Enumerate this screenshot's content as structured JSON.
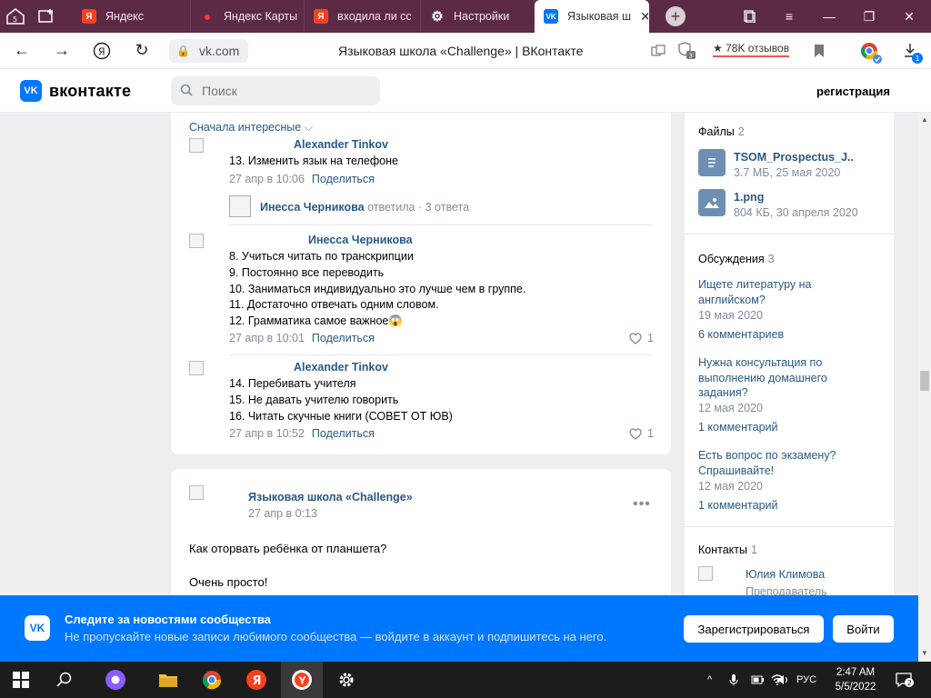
{
  "browser": {
    "tabs": [
      {
        "label": "Яндекс",
        "color": "#fc3f1d",
        "glyph": "Я"
      },
      {
        "label": "Яндекс Карты",
        "color": "#ff3333",
        "glyph": "●"
      },
      {
        "label": "входила ли сс",
        "color": "#fc3f1d",
        "glyph": "Я"
      },
      {
        "label": "Настройки",
        "color": "#5d2a45",
        "glyph": "⚙"
      },
      {
        "label": "Языковая ш",
        "color": "#0077ff",
        "glyph": "VK"
      }
    ],
    "address": "vk.com",
    "page_title": "Языковая школа «Challenge» | ВКонтакте",
    "reviews": "★ 78K отзывов",
    "badge_shield": "3",
    "badge_download": "1"
  },
  "vk_header": {
    "logo_text": "VK",
    "wordmark": "вконтакте",
    "search_placeholder": "Поиск",
    "register_link": "регистрация"
  },
  "comments": {
    "sort_label": "Сначала интересные",
    "share_label": "Поделиться",
    "c1": {
      "author": "Alexander Tinkov",
      "text": "13. Изменить язык на телефоне",
      "date": "27 апр в 10:06"
    },
    "reply_summary": {
      "author": "Инесса Черникова",
      "verb": "ответила",
      "count": "3 ответа"
    },
    "c2": {
      "author": "Инесса Черникова",
      "lines": [
        "8. Учиться читать по транскрипции",
        "9. Постоянно все переводить",
        "10. Заниматься индивидуально это лучше чем в группе.",
        "11. Достаточно отвечать одним словом.",
        "12. Грамматика самое важное😱"
      ],
      "date": "27 апр в 10:01",
      "likes": "1"
    },
    "c3": {
      "author": "Alexander Tinkov",
      "lines": [
        "14. Перебивать учителя",
        "15. Не давать учителю говорить",
        "16. Читать скучные книги (СОВЕТ ОТ ЮВ)"
      ],
      "date": "27 апр в 10:52",
      "likes": "1"
    }
  },
  "post": {
    "author": "Языковая школа «Challenge»",
    "date": "27 апр в 0:13",
    "more": "•••",
    "text1": "Как оторвать ребёнка от планшета?",
    "text2": "Очень просто!"
  },
  "right": {
    "files": {
      "title": "Файлы",
      "count": "2",
      "items": [
        {
          "name": "TSOM_Prospectus_J..",
          "meta": "3.7 МБ, 25 мая 2020"
        },
        {
          "name": "1.png",
          "meta": "804 КБ, 30 апреля 2020"
        }
      ]
    },
    "discussions": {
      "title": "Обсуждения",
      "count": "3",
      "items": [
        {
          "title_lines": [
            "Ищете литературу на",
            "английском?"
          ],
          "date": "19 мая 2020",
          "comments": "6 комментариев"
        },
        {
          "title_lines": [
            "Нужна консультация по",
            "выполнению домашнего",
            "задания?"
          ],
          "date": "12 мая 2020",
          "comments": "1 комментарий"
        },
        {
          "title_lines": [
            "Есть вопрос по экзамену?",
            "Спрашивайте!"
          ],
          "date": "12 мая 2020",
          "comments": "1 комментарий"
        }
      ]
    },
    "contacts": {
      "title": "Контакты",
      "count": "1",
      "name": "Юлия Климова",
      "role": "Преподаватель"
    }
  },
  "banner": {
    "logo_text": "VK",
    "title": "Следите за новостями сообщества",
    "subtitle": "Не пропускайте новые записи любимого сообщества — войдите в аккаунт и подпишитесь на него.",
    "register": "Зарегистрироваться",
    "login": "Войти"
  },
  "taskbar": {
    "lang": "РУС",
    "time": "2:47 AM",
    "date": "5/5/2022",
    "notif_count": "2"
  }
}
